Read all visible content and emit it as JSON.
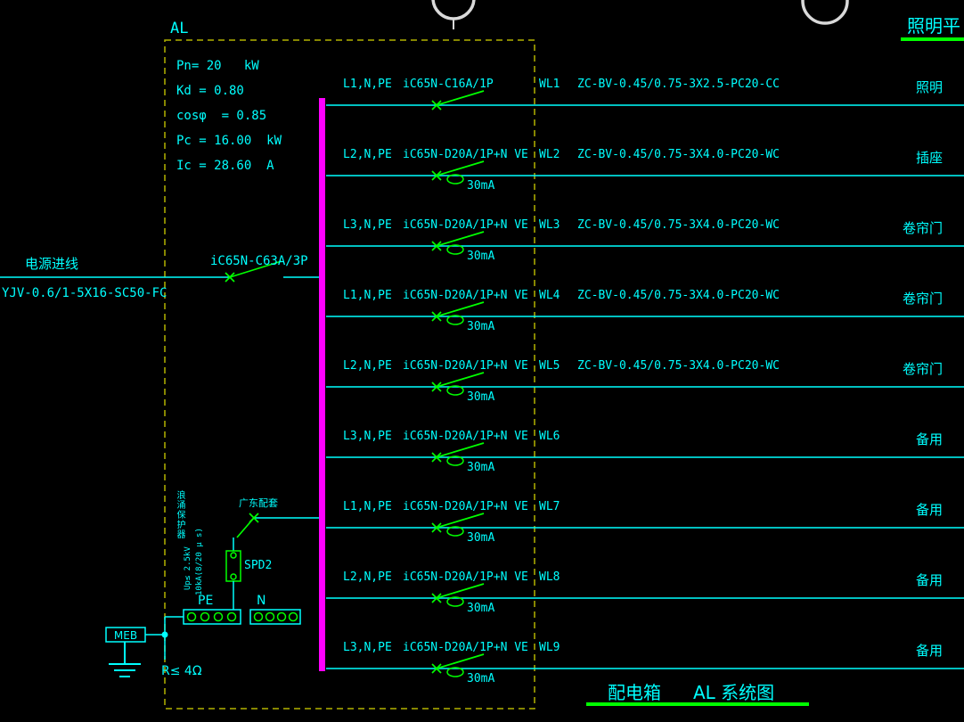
{
  "colors": {
    "bg": "#000000",
    "cyan": "#00ffff",
    "green": "#00ff00",
    "magenta": "#ff00ff",
    "dash": "#b3b300",
    "bubble": "#d9d9d9"
  },
  "sheet_title_partial": "照明平",
  "incoming": {
    "label": "电源进线",
    "cable": "YJV-0.6/1-5X16-SC50-FC",
    "breaker": "iC65N-C63A/3P"
  },
  "panel": {
    "name": "AL",
    "params": [
      "Pn= 20   kW",
      "Kd = 0.80",
      "cosφ  = 0.85",
      "Pc = 16.00  kW",
      "Ic = 28.60  A"
    ]
  },
  "circuits": [
    {
      "phase": "L1,N,PE",
      "breaker": "iC65N-C16A/1P",
      "id": "WL1",
      "cable": "ZC-BV-0.45/0.75-3X2.5-PC20-CC",
      "rcd_label": "",
      "usage": "照明"
    },
    {
      "phase": "L2,N,PE",
      "breaker": "iC65N-D20A/1P+N VE",
      "id": "WL2",
      "cable": "ZC-BV-0.45/0.75-3X4.0-PC20-WC",
      "rcd_label": "30mA",
      "usage": "插座"
    },
    {
      "phase": "L3,N,PE",
      "breaker": "iC65N-D20A/1P+N VE",
      "id": "WL3",
      "cable": "ZC-BV-0.45/0.75-3X4.0-PC20-WC",
      "rcd_label": "30mA",
      "usage": "卷帘门"
    },
    {
      "phase": "L1,N,PE",
      "breaker": "iC65N-D20A/1P+N VE",
      "id": "WL4",
      "cable": "ZC-BV-0.45/0.75-3X4.0-PC20-WC",
      "rcd_label": "30mA",
      "usage": "卷帘门"
    },
    {
      "phase": "L2,N,PE",
      "breaker": "iC65N-D20A/1P+N VE",
      "id": "WL5",
      "cable": "ZC-BV-0.45/0.75-3X4.0-PC20-WC",
      "rcd_label": "30mA",
      "usage": "卷帘门"
    },
    {
      "phase": "L3,N,PE",
      "breaker": "iC65N-D20A/1P+N VE",
      "id": "WL6",
      "cable": "",
      "rcd_label": "30mA",
      "usage": "备用"
    },
    {
      "phase": "L1,N,PE",
      "breaker": "iC65N-D20A/1P+N VE",
      "id": "WL7",
      "cable": "",
      "rcd_label": "30mA",
      "usage": "备用"
    },
    {
      "phase": "L2,N,PE",
      "breaker": "iC65N-D20A/1P+N VE",
      "id": "WL8",
      "cable": "",
      "rcd_label": "30mA",
      "usage": "备用"
    },
    {
      "phase": "L3,N,PE",
      "breaker": "iC65N-D20A/1P+N VE",
      "id": "WL9",
      "cable": "",
      "rcd_label": "30mA",
      "usage": "备用"
    }
  ],
  "spd": {
    "note": "广东配套",
    "device": "SPD2",
    "vertical_label": "浪涌保护器",
    "spec1": "Up≤ 2.5kV",
    "spec2": "10kA(8/20 μ s)"
  },
  "earthing": {
    "pe_label": "PE",
    "n_label": "N",
    "meb_label": "MEB",
    "resistance": "R≤ 4Ω"
  },
  "footer": {
    "box": "配电箱",
    "title": "AL 系统图"
  }
}
